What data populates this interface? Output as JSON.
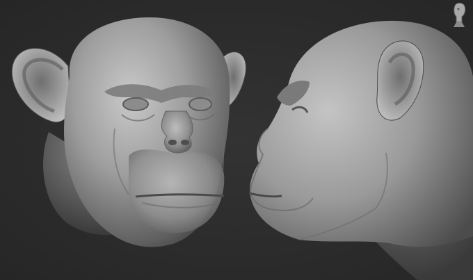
{
  "viewport": {
    "background": "#2b2b2b",
    "material_color": "#9a9a9a"
  },
  "models": [
    {
      "name": "chimpanzee-head",
      "view": "front"
    },
    {
      "name": "chimpanzee-head",
      "view": "side-profile"
    }
  ],
  "navigation": {
    "icon": "head-orientation-gizmo-icon"
  }
}
